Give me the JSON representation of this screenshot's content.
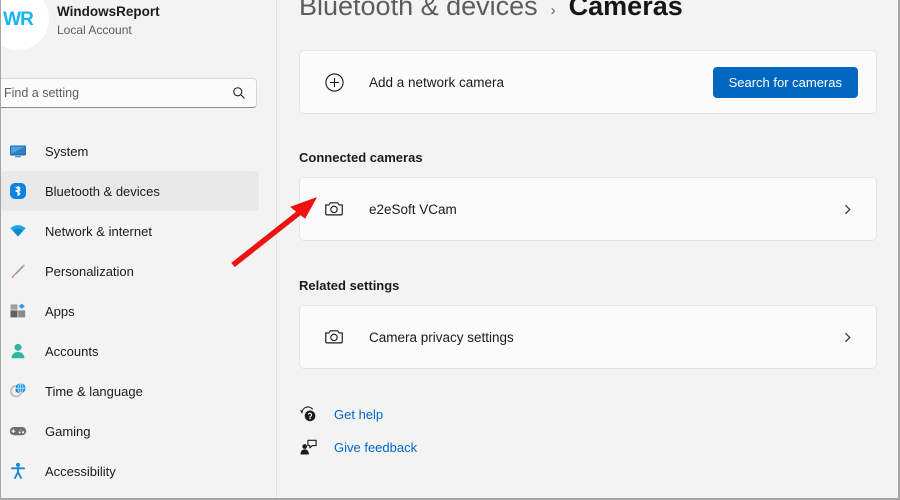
{
  "account": {
    "name": "WindowsReport",
    "type": "Local Account",
    "avatar_initials": "WR",
    "avatar_color": "#12b5f0"
  },
  "search": {
    "placeholder": "Find a setting",
    "value": "",
    "icon": "search-icon"
  },
  "sidebar": {
    "items": [
      {
        "label": "System",
        "icon": "system-icon",
        "selected": false
      },
      {
        "label": "Bluetooth & devices",
        "icon": "bluetooth-icon",
        "selected": true
      },
      {
        "label": "Network & internet",
        "icon": "network-icon",
        "selected": false
      },
      {
        "label": "Personalization",
        "icon": "personalization-icon",
        "selected": false
      },
      {
        "label": "Apps",
        "icon": "apps-icon",
        "selected": false
      },
      {
        "label": "Accounts",
        "icon": "accounts-icon",
        "selected": false
      },
      {
        "label": "Time & language",
        "icon": "time-language-icon",
        "selected": false
      },
      {
        "label": "Gaming",
        "icon": "gaming-icon",
        "selected": false
      },
      {
        "label": "Accessibility",
        "icon": "accessibility-icon",
        "selected": false
      }
    ]
  },
  "breadcrumb": {
    "parent": "Bluetooth & devices",
    "separator": "›",
    "current": "Cameras"
  },
  "add_camera_card": {
    "icon": "plus-circle-icon",
    "label": "Add a network camera",
    "button_label": "Search for cameras",
    "button_color": "#0067c0"
  },
  "connected_cameras": {
    "heading": "Connected cameras",
    "items": [
      {
        "label": "e2eSoft VCam",
        "icon": "camera-icon",
        "chevron": "chevron-right-icon"
      }
    ]
  },
  "related_settings": {
    "heading": "Related settings",
    "items": [
      {
        "label": "Camera privacy settings",
        "icon": "camera-icon",
        "chevron": "chevron-right-icon"
      }
    ]
  },
  "footer_links": [
    {
      "label": "Get help",
      "icon": "help-icon",
      "color": "#0066cc"
    },
    {
      "label": "Give feedback",
      "icon": "feedback-icon",
      "color": "#0066cc"
    }
  ],
  "annotation": {
    "type": "arrow",
    "color": "#ee1111",
    "points_to": "e2eSoft VCam camera icon"
  }
}
